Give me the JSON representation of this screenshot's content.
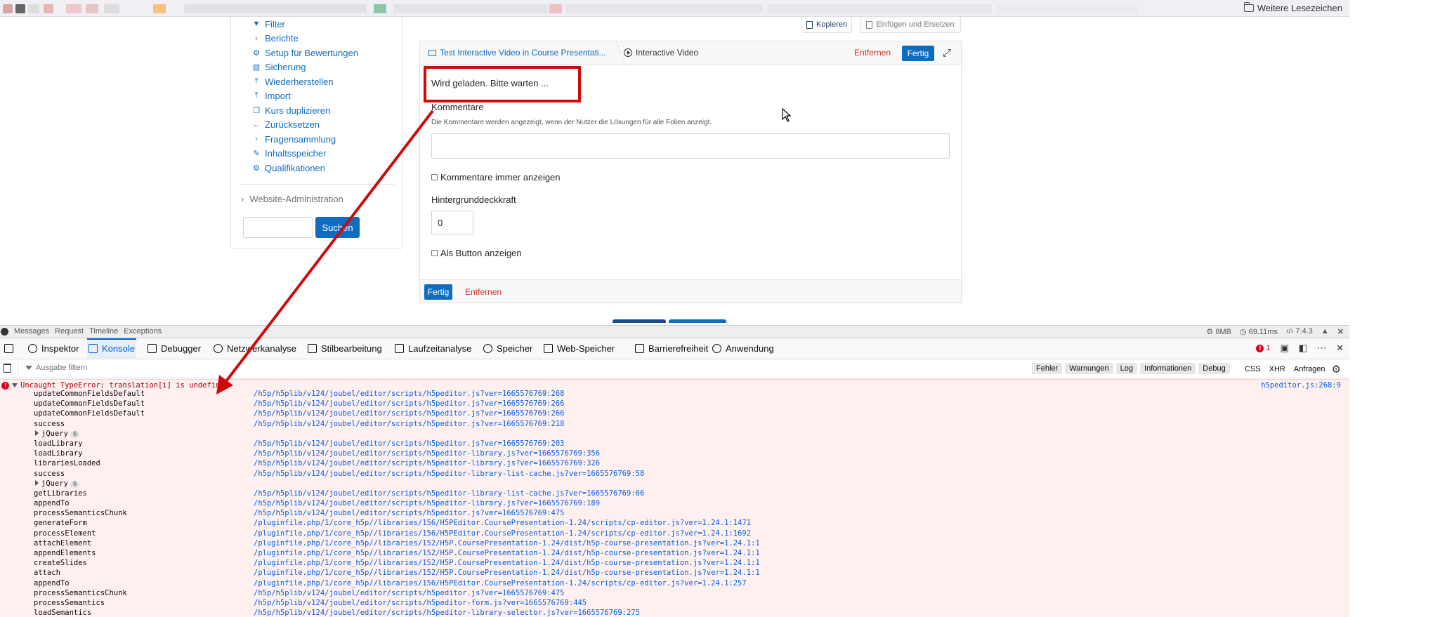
{
  "bookmarks_bar": {
    "more_label": "Weitere Lesezeichen",
    "icon": "folder-icon"
  },
  "nav": {
    "items": [
      {
        "label": "Filter",
        "icon": "filter-icon"
      },
      {
        "label": "Berichte",
        "icon": "chevron-right-icon"
      },
      {
        "label": "Setup für Bewertungen",
        "icon": "gear-icon"
      },
      {
        "label": "Sicherung",
        "icon": "file-icon"
      },
      {
        "label": "Wiederherstellen",
        "icon": "upload-icon"
      },
      {
        "label": "Import",
        "icon": "upload-icon"
      },
      {
        "label": "Kurs duplizieren",
        "icon": "copy-icon"
      },
      {
        "label": "Zurücksetzen",
        "icon": "arrow-left-icon"
      },
      {
        "label": "Fragensammlung",
        "icon": "chevron-right-icon"
      },
      {
        "label": "Inhaltsspeicher",
        "icon": "brush-icon"
      },
      {
        "label": "Qualifikationen",
        "icon": "gear-icon"
      }
    ],
    "site_admin": "Website-Administration",
    "search_button": "Suchen",
    "search_value": ""
  },
  "clipboard": {
    "copy_label": "Kopieren",
    "paste_label": "Einfügen und Ersetzen"
  },
  "editor": {
    "crumb_parent": "Test Interactive Video in Course Presentati...",
    "crumb_current": "Interactive Video",
    "remove_label": "Entfernen",
    "done_label": "Fertig",
    "loading_text": "Wird geladen. Bitte warten ...",
    "comments_label": "Kommentare",
    "comments_description": "Die Kommentare werden angezeigt, wenn der Nutzer die Lösungen für alle Folien anzeigt.",
    "comments_value": "",
    "always_show_comments": "Kommentare immer anzeigen",
    "bg_opacity_label": "Hintergrunddeckkraft",
    "bg_opacity_value": "0",
    "show_as_button": "Als Button anzeigen",
    "footer_done": "Fertig",
    "footer_remove": "Entfernen"
  },
  "debugbar": {
    "tabs": [
      "Messages",
      "Request",
      "Timeline",
      "Exceptions"
    ],
    "memory": "8MB",
    "time": "69.11ms",
    "php_version": "7.4.3"
  },
  "devtools": {
    "tabs": [
      {
        "label": "Inspektor",
        "icon": "inspector-icon"
      },
      {
        "label": "Konsole",
        "icon": "console-icon",
        "active": true
      },
      {
        "label": "Debugger",
        "icon": "debugger-icon"
      },
      {
        "label": "Netzwerkanalyse",
        "icon": "network-icon"
      },
      {
        "label": "Stilbearbeitung",
        "icon": "style-editor-icon"
      },
      {
        "label": "Laufzeitanalyse",
        "icon": "performance-icon"
      },
      {
        "label": "Speicher",
        "icon": "memory-icon"
      },
      {
        "label": "Web-Speicher",
        "icon": "storage-icon"
      },
      {
        "label": "Barrierefreiheit",
        "icon": "accessibility-icon"
      },
      {
        "label": "Anwendung",
        "icon": "application-icon"
      }
    ],
    "error_count": "1",
    "filter_placeholder": "Ausgabe filtern",
    "levels": [
      "Fehler",
      "Warnungen",
      "Log",
      "Informationen",
      "Debug"
    ],
    "request_filters": [
      "CSS",
      "XHR",
      "Anfragen"
    ]
  },
  "console": {
    "error_message": "Uncaught TypeError: translation[i] is undefined",
    "error_source": "h5peditor.js:268:9",
    "frames": [
      {
        "fn": "updateCommonFieldsDefault",
        "url": "/h5p/h5plib/v124/joubel/editor/scripts/h5peditor.js?ver=1665576769:268"
      },
      {
        "fn": "updateCommonFieldsDefault",
        "url": "/h5p/h5plib/v124/joubel/editor/scripts/h5peditor.js?ver=1665576769:266"
      },
      {
        "fn": "updateCommonFieldsDefault",
        "url": "/h5p/h5plib/v124/joubel/editor/scripts/h5peditor.js?ver=1665576769:266"
      },
      {
        "fn": "success",
        "url": "/h5p/h5plib/v124/joubel/editor/scripts/h5peditor.js?ver=1665576769:218"
      },
      {
        "fn": "jQuery",
        "group": "6",
        "url": ""
      },
      {
        "fn": "loadLibrary",
        "url": "/h5p/h5plib/v124/joubel/editor/scripts/h5peditor.js?ver=1665576769:203"
      },
      {
        "fn": "loadLibrary",
        "url": "/h5p/h5plib/v124/joubel/editor/scripts/h5peditor-library.js?ver=1665576769:356"
      },
      {
        "fn": "librariesLoaded",
        "url": "/h5p/h5plib/v124/joubel/editor/scripts/h5peditor-library.js?ver=1665576769:326"
      },
      {
        "fn": "success",
        "url": "/h5p/h5plib/v124/joubel/editor/scripts/h5peditor-library-list-cache.js?ver=1665576769:58"
      },
      {
        "fn": "jQuery",
        "group": "6",
        "url": ""
      },
      {
        "fn": "getLibraries",
        "url": "/h5p/h5plib/v124/joubel/editor/scripts/h5peditor-library-list-cache.js?ver=1665576769:66"
      },
      {
        "fn": "appendTo",
        "url": "/h5p/h5plib/v124/joubel/editor/scripts/h5peditor-library.js?ver=1665576769:189"
      },
      {
        "fn": "processSemanticsChunk",
        "url": "/h5p/h5plib/v124/joubel/editor/scripts/h5peditor.js?ver=1665576769:475"
      },
      {
        "fn": "generateForm",
        "url": "/pluginfile.php/1/core_h5p//libraries/156/H5PEditor.CoursePresentation-1.24/scripts/cp-editor.js?ver=1.24.1:1471"
      },
      {
        "fn": "processElement",
        "url": "/pluginfile.php/1/core_h5p//libraries/156/H5PEditor.CoursePresentation-1.24/scripts/cp-editor.js?ver=1.24.1:1692"
      },
      {
        "fn": "attachElement",
        "url": "/pluginfile.php/1/core_h5p//libraries/152/H5P.CoursePresentation-1.24/dist/h5p-course-presentation.js?ver=1.24.1:1"
      },
      {
        "fn": "appendElements",
        "url": "/pluginfile.php/1/core_h5p//libraries/152/H5P.CoursePresentation-1.24/dist/h5p-course-presentation.js?ver=1.24.1:1"
      },
      {
        "fn": "createSlides",
        "url": "/pluginfile.php/1/core_h5p//libraries/152/H5P.CoursePresentation-1.24/dist/h5p-course-presentation.js?ver=1.24.1:1"
      },
      {
        "fn": "attach",
        "url": "/pluginfile.php/1/core_h5p//libraries/152/H5P.CoursePresentation-1.24/dist/h5p-course-presentation.js?ver=1.24.1:1"
      },
      {
        "fn": "appendTo",
        "url": "/pluginfile.php/1/core_h5p//libraries/156/H5PEditor.CoursePresentation-1.24/scripts/cp-editor.js?ver=1.24.1:257"
      },
      {
        "fn": "processSemanticsChunk",
        "url": "/h5p/h5plib/v124/joubel/editor/scripts/h5peditor.js?ver=1665576769:475"
      },
      {
        "fn": "processSemantics",
        "url": "/h5p/h5plib/v124/joubel/editor/scripts/h5peditor-form.js?ver=1665576769:445"
      },
      {
        "fn": "loadSemantics",
        "url": "/h5p/h5plib/v124/joubel/editor/scripts/h5peditor-library-selector.js?ver=1665576769:275"
      }
    ]
  },
  "colors": {
    "link": "#0f6cbf",
    "danger": "#ca3120",
    "annotation": "#cc0a0a",
    "console_error_bg": "#fff0f0",
    "devtools_active": "#0060df"
  }
}
